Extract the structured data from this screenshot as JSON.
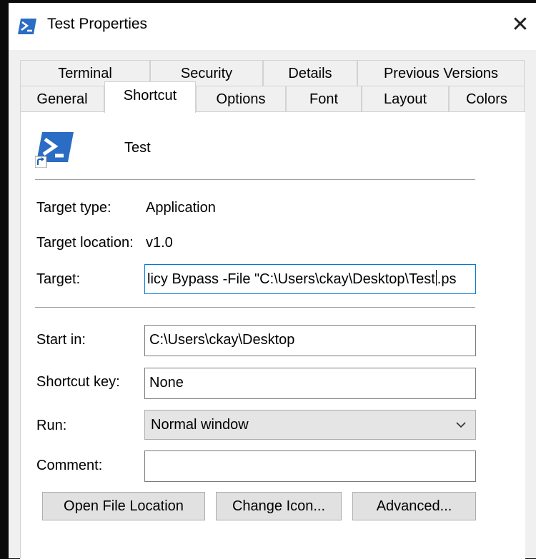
{
  "window": {
    "title": "Test Properties",
    "close_glyph": "✕",
    "icon": "powershell-icon"
  },
  "tabs": {
    "row1": [
      "Terminal",
      "Security",
      "Details",
      "Previous Versions"
    ],
    "row2": [
      "General",
      "Shortcut",
      "Options",
      "Font",
      "Layout",
      "Colors"
    ],
    "active": "Shortcut"
  },
  "shortcut": {
    "name": "Test",
    "target_type_label": "Target type:",
    "target_type_value": "Application",
    "target_location_label": "Target location:",
    "target_location_value": "v1.0",
    "target_label": "Target:",
    "target_before_caret": "licy Bypass -File \"C:\\Users\\ckay\\Desktop\\Test",
    "target_after_caret": ".ps",
    "start_in_label": "Start in:",
    "start_in_value": "C:\\Users\\ckay\\Desktop",
    "shortcut_key_label": "Shortcut key:",
    "shortcut_key_value": "None",
    "run_label": "Run:",
    "run_value": "Normal window",
    "comment_label": "Comment:",
    "comment_value": ""
  },
  "buttons": {
    "open_file_location": "Open File Location",
    "change_icon": "Change Icon...",
    "advanced": "Advanced..."
  },
  "colors": {
    "accent": "#0078d7",
    "powershell_blue": "#2b6cc4"
  }
}
